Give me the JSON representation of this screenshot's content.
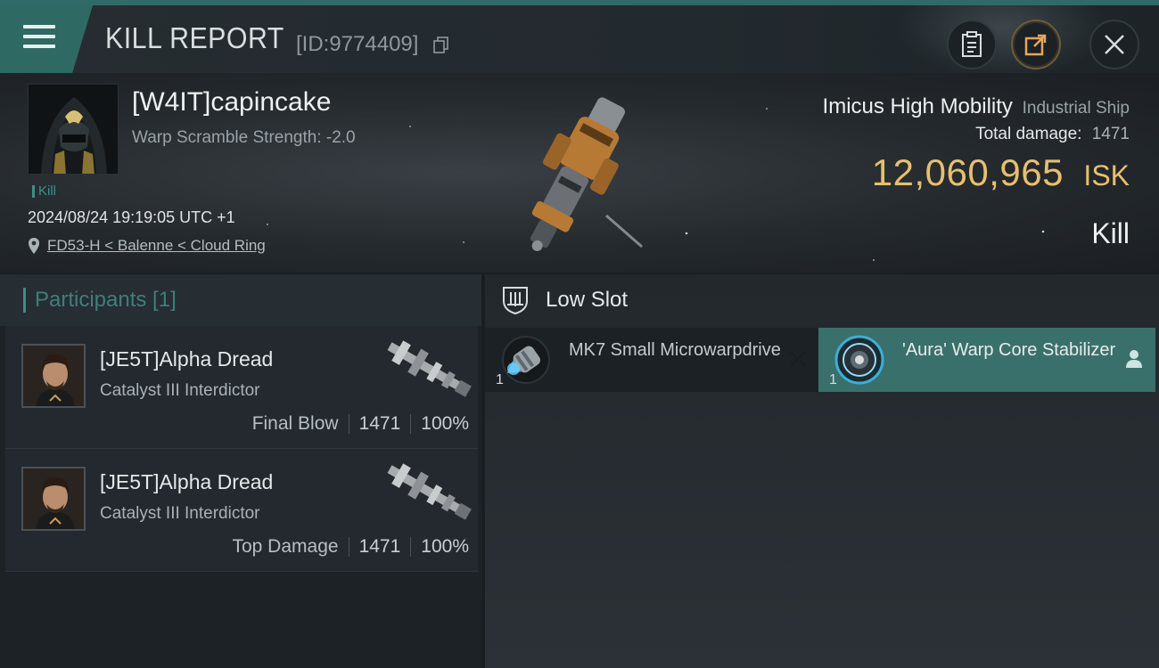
{
  "header": {
    "title": "KILL REPORT",
    "report_id": "[ID:9774409]",
    "icons": {
      "menu": "hamburger-menu-icon",
      "copy": "copy-icon",
      "clipboard": "clipboard-icon",
      "share": "share-icon",
      "close": "close-icon"
    }
  },
  "victim": {
    "pilot_name": "[W4IT]capincake",
    "warp_scramble": "Warp Scramble Strength: -2.0",
    "tag": "Kill",
    "timestamp": "2024/08/24 19:19:05 UTC +1",
    "location": "FD53-H < Balenne < Cloud Ring",
    "ship_name": "Imicus High Mobility",
    "ship_class": "Industrial Ship",
    "total_damage_label": "Total damage:",
    "total_damage": "1471",
    "isk_value": "12,060,965",
    "isk_unit": "ISK",
    "result": "Kill"
  },
  "participants": {
    "header": "Participants [1]",
    "rows": [
      {
        "name": "[JE5T]Alpha Dread",
        "ship": "Catalyst III Interdictor",
        "role": "Final Blow",
        "damage": "1471",
        "percent": "100%"
      },
      {
        "name": "[JE5T]Alpha Dread",
        "ship": "Catalyst III Interdictor",
        "role": "Top Damage",
        "damage": "1471",
        "percent": "100%"
      }
    ]
  },
  "slots": {
    "header": "Low Slot",
    "modules": [
      {
        "name": "MK7 Small Microwarpdrive",
        "qty": "1",
        "state": "destroyed"
      },
      {
        "name": "'Aura' Warp Core Stabilizer",
        "qty": "1",
        "state": "dropped"
      }
    ]
  },
  "colors": {
    "accent": "#3c8f86",
    "isk": "#e8c06a",
    "panel": "#23292e"
  }
}
